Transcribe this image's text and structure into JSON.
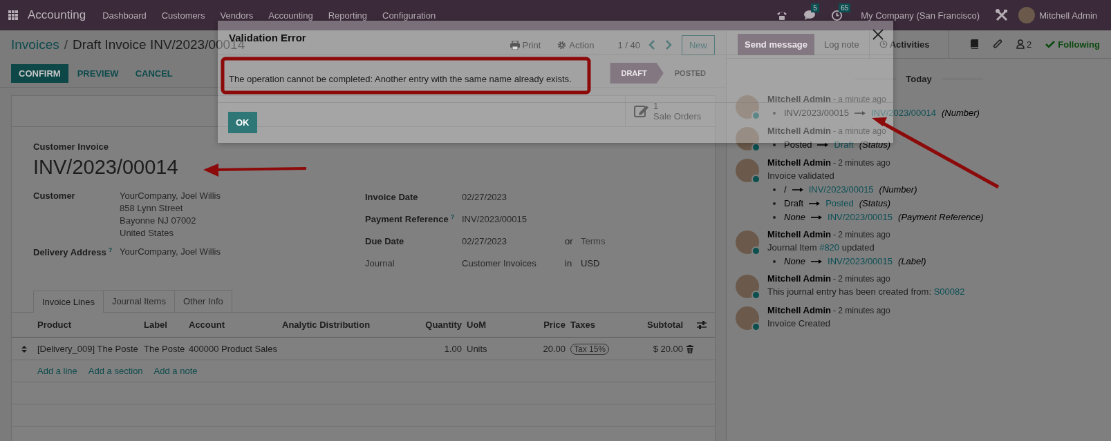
{
  "top_nav": {
    "app_name": "Accounting",
    "menu": [
      "Dashboard",
      "Customers",
      "Vendors",
      "Accounting",
      "Reporting",
      "Configuration"
    ],
    "chat_count": "5",
    "activity_count": "65",
    "company": "My Company (San Francisco)",
    "user": "Mitchell Admin"
  },
  "breadcrumb": {
    "parent": "Invoices",
    "separator": "/",
    "current": "Draft Invoice INV/2023/00014"
  },
  "record_actions": {
    "print": "Print",
    "action": "Action",
    "pager": "1 / 40",
    "new": "New"
  },
  "buttons": [
    {
      "label": "CONFIRM",
      "kind": "primary"
    },
    {
      "label": "PREVIEW",
      "kind": "secondary"
    },
    {
      "label": "CANCEL",
      "kind": "secondary"
    }
  ],
  "status_steps": [
    {
      "label": "DRAFT",
      "selected": true
    },
    {
      "label": "POSTED",
      "selected": false
    }
  ],
  "smart_button": {
    "count": "1",
    "label": "Sale Orders"
  },
  "invoice": {
    "type_label": "Customer Invoice",
    "number": "INV/2023/00014",
    "left_fields": [
      {
        "label": "Customer",
        "lines": [
          "YourCompany, Joel Willis",
          "858 Lynn Street",
          "Bayonne NJ 07002",
          "United States"
        ]
      },
      {
        "label": "Delivery Address",
        "help": "?",
        "lines": [
          "YourCompany, Joel Willis"
        ]
      }
    ],
    "right_fields": [
      {
        "label": "Invoice Date",
        "muted": false,
        "value": "02/27/2023"
      },
      {
        "label": "Payment Reference",
        "help": "?",
        "muted": false,
        "value": "INV/2023/00015"
      },
      {
        "label": "Due Date",
        "muted": false,
        "value": "02/27/2023",
        "connector": "or",
        "extra_placeholder": "Terms"
      },
      {
        "label": "Journal",
        "muted": true,
        "value": "Customer Invoices",
        "connector": "in",
        "extra_value": "USD"
      }
    ]
  },
  "tabs": [
    {
      "label": "Invoice Lines",
      "selected": true
    },
    {
      "label": "Journal Items",
      "selected": false
    },
    {
      "label": "Other Info",
      "selected": false
    }
  ],
  "table": {
    "columns": [
      "Product",
      "Label",
      "Account",
      "Analytic Distribution",
      "Quantity",
      "UoM",
      "Price",
      "Taxes",
      "Subtotal"
    ],
    "rows": [
      {
        "product": "[Delivery_009] The Poste",
        "label": "The Poste",
        "account": "400000 Product Sales",
        "quantity": "1.00",
        "uom": "Units",
        "price": "20.00",
        "taxes": [
          "Tax 15%"
        ],
        "subtotal": "$ 20.00"
      }
    ],
    "add_links": [
      "Add a line",
      "Add a section",
      "Add a note"
    ]
  },
  "chatter": {
    "send_message": "Send message",
    "log_note": "Log note",
    "activities": "Activities",
    "followers_count": "2",
    "following": "Following",
    "date_separator": "Today",
    "messages": [
      {
        "author": "Mitchell Admin",
        "time": "- a minute ago",
        "changes": [
          {
            "old": "INV/2023/00015",
            "old_italic": false,
            "new": "INV/2023/00014",
            "field": "(Number)"
          }
        ]
      },
      {
        "author": "Mitchell Admin",
        "time": "- a minute ago",
        "changes": [
          {
            "old": "Posted",
            "old_italic": false,
            "new": "Draft",
            "field": "(Status)"
          }
        ]
      },
      {
        "author": "Mitchell Admin",
        "time": "- 2 minutes ago",
        "body": [
          {
            "text": "Invoice validated",
            "link": false
          }
        ],
        "changes": [
          {
            "old": "/",
            "old_italic": false,
            "new": "INV/2023/00015",
            "field": "(Number)"
          },
          {
            "old": "Draft",
            "old_italic": false,
            "new": "Posted",
            "field": "(Status)"
          },
          {
            "old": "None",
            "old_italic": true,
            "new": "INV/2023/00015",
            "field": "(Payment Reference)"
          }
        ]
      },
      {
        "author": "Mitchell Admin",
        "time": "- 2 minutes ago",
        "body": [
          {
            "text": "Journal Item ",
            "link": false
          },
          {
            "text": "#820",
            "link": true
          },
          {
            "text": " updated",
            "link": false
          }
        ],
        "changes": [
          {
            "old": "None",
            "old_italic": true,
            "new": "INV/2023/00015",
            "field": "(Label)"
          }
        ]
      },
      {
        "author": "Mitchell Admin",
        "time": "- 2 minutes ago",
        "body": [
          {
            "text": "This journal entry has been created from: ",
            "link": false
          },
          {
            "text": "S00082",
            "link": true
          }
        ]
      },
      {
        "author": "Mitchell Admin",
        "time": "- 2 minutes ago",
        "body": [
          {
            "text": "Invoice Created",
            "link": false
          }
        ]
      }
    ]
  },
  "dialog": {
    "title": "Validation Error",
    "message": "The operation cannot be completed: Another entry with the same name already exists.",
    "ok": "OK"
  }
}
